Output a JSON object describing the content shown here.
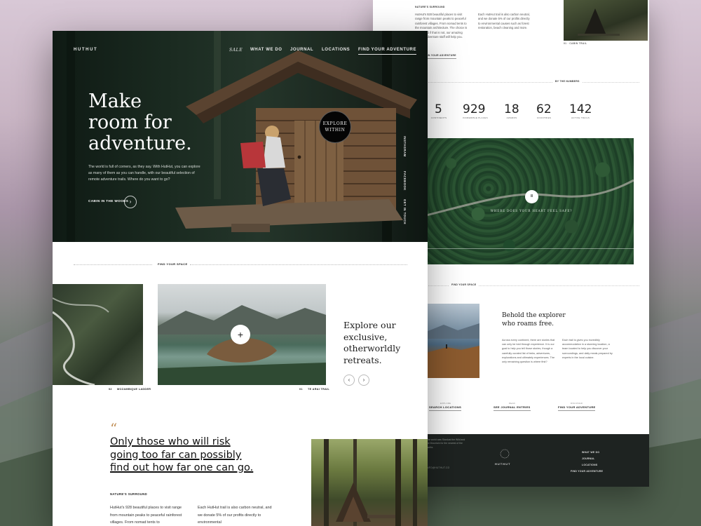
{
  "front": {
    "brand": "HUTHUT",
    "nav": {
      "tagline": "Sale",
      "items": [
        "WHAT WE DO",
        "JOURNAL",
        "LOCATIONS",
        "FIND YOUR ADVENTURE"
      ]
    },
    "hero": {
      "title_lines": [
        "Make",
        "room for",
        "adventure."
      ],
      "body": "The world is full of corners, as they say. With HutHut, you can explore as many of them as you can handle, with our beautiful selection of remote adventure trails. Where do you want to go?",
      "cta": "CABIN IN THE WOODS",
      "badge_lines": [
        "EXPLORE",
        "WITHIN"
      ],
      "side_labels": [
        "INSTAGRAM",
        "FACEBOOK",
        "GET IN TOUCH"
      ]
    },
    "find_space": {
      "label": "FIND YOUR SPACE",
      "photos": [
        {
          "num": "02",
          "name": "MOZAMBIQUE LADDER"
        },
        {
          "num": "01",
          "name": "TE ARAI TRAIL"
        }
      ],
      "heading": "Explore our exclusive, otherworldly retreats.",
      "prev": "‹",
      "next": "›",
      "plus": "+"
    },
    "quote": {
      "mark": "“",
      "lines": [
        "Only those who will risk",
        "going too far can possibly",
        "find out how far one can go."
      ],
      "kicker": "NATURE'S SURROUND",
      "col1": "HutHut's 928 beautiful places to visit range from mountain peaks to peaceful rainforest villages. From nomad tents to",
      "col2": "Each HutHut trail is also carbon neutral, and we donate 5% of our profits directly to environmental"
    }
  },
  "back": {
    "top": {
      "kicker": "NATURE'S SURROUND",
      "col1": "HutHut's 928 beautiful places to visit range from mountain peaks to peaceful rainforest villages. From nomad tents to the mountain architecture. The choice is yours. And if that is not, our amazing team of adventure staff will help you.",
      "col2": "Each HutHut trail is also carbon neutral, and we donate 5% of our profits directly to environmental causes such as forest restoration, beach cleaning and more.",
      "link": "ON YOUR ADVENTURE",
      "photo_label": "01 · CABIN TRAIL"
    },
    "numbers": {
      "label": "BY THE NUMBERS",
      "stats": [
        {
          "value": "5",
          "label": "CONTINENTS"
        },
        {
          "value": "929",
          "label": "INCREDIBLE PLACES"
        },
        {
          "value": "18",
          "label": "AWARDS"
        },
        {
          "value": "62",
          "label": "COUNTRIES"
        },
        {
          "value": "142",
          "label": "ACTIVE TRAILS"
        }
      ]
    },
    "video": {
      "caption": "WHERE DOES YOUR HEART FEEL SAFE?",
      "play": "II"
    },
    "explorer": {
      "label": "FIND YOUR SPACE",
      "heading": "Behold the explorer who roams free.",
      "col1": "Across every continent, there are stories that can only be told through experience. It is our goal to help you tell those stories, though a carefully curated list of treks, adventures, explorations and ultimately experiences. The only remaining question is where first?",
      "col2": "Each trail is gives you incredibly accommodation in a stunning location, a team located to help you discover your surroundings, and daily meals prepared by experts in the local cuisine."
    },
    "links": [
      {
        "kicker": "EXPLORE",
        "label": "SEARCH LOCATIONS"
      },
      {
        "kicker": "READ",
        "label": "SEE JOURNAL ENTRIES"
      },
      {
        "kicker": "DISCOVER",
        "label": "FIND YOUR ADVENTURE"
      }
    ],
    "footer": {
      "brand": "HUTHUT",
      "text": "The world was Stardust the Wild and the Mountain for the nearest of the earths",
      "contact": "INFO@HUTHUT.CO",
      "nav": [
        "WHAT WE DO",
        "JOURNAL",
        "LOCATIONS",
        "FIND YOUR ADVENTURE"
      ]
    }
  }
}
